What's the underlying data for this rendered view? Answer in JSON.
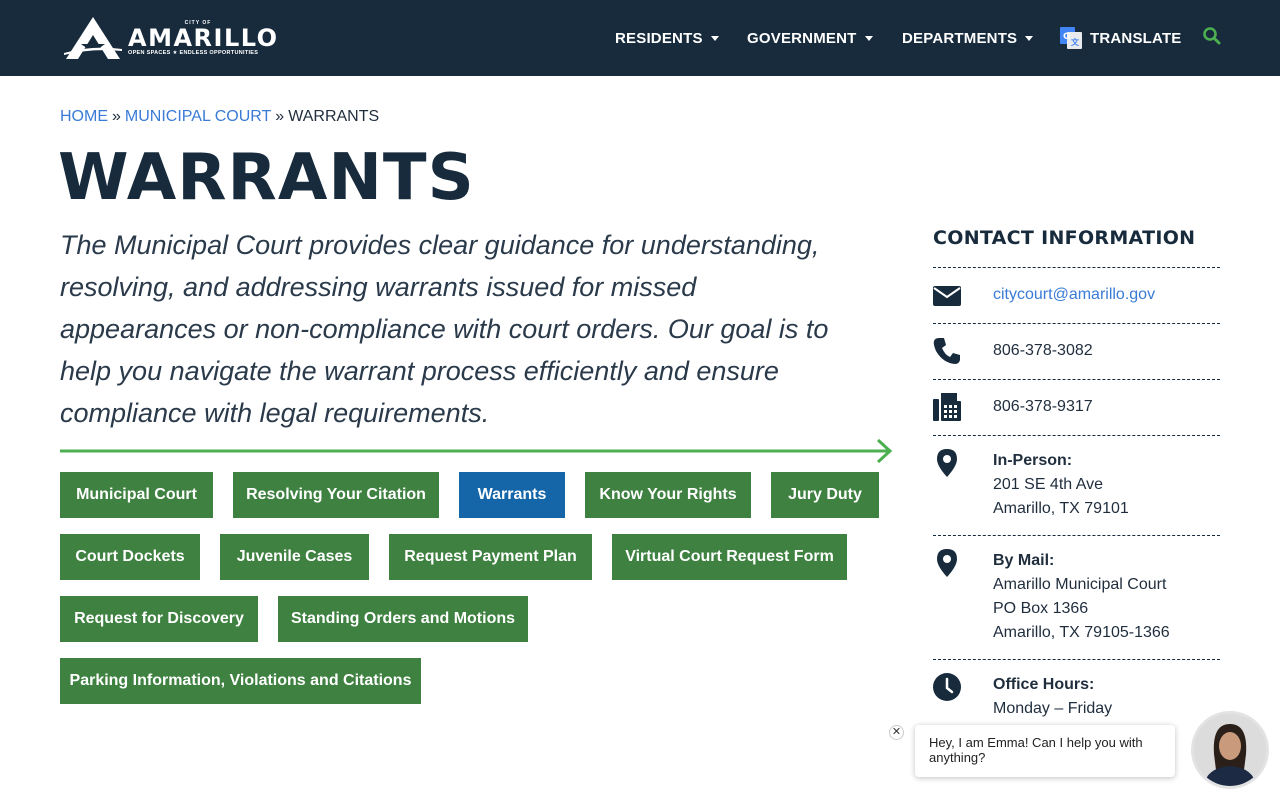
{
  "header": {
    "logo": {
      "city_of": "CITY OF",
      "name": "AMARILLO",
      "tagline": "OPEN SPACES ★ ENDLESS OPPORTUNITIES"
    },
    "nav": [
      {
        "label": "RESIDENTS"
      },
      {
        "label": "GOVERNMENT"
      },
      {
        "label": "DEPARTMENTS"
      },
      {
        "label": "TRANSLATE"
      }
    ],
    "search_icon": "search-icon",
    "colors": {
      "background": "#172b3d",
      "search": "#4caf50"
    }
  },
  "breadcrumb": {
    "home": "HOME",
    "separator": "»",
    "court": "MUNICIPAL COURT",
    "current": "WARRANTS"
  },
  "page": {
    "title": "WARRANTS",
    "intro": "The Municipal Court provides clear guidance for understanding, resolving, and addressing warrants issued for missed appearances or non-compliance with court orders. Our goal is to help you navigate the warrant process efficiently and ensure compliance with legal requirements."
  },
  "section_buttons": [
    {
      "label": "Municipal Court",
      "active": false
    },
    {
      "label": "Resolving Your Citation",
      "active": false
    },
    {
      "label": "Warrants",
      "active": true
    },
    {
      "label": "Know Your Rights",
      "active": false
    },
    {
      "label": "Jury Duty",
      "active": false
    },
    {
      "label": "Court Dockets",
      "active": false
    },
    {
      "label": "Juvenile Cases",
      "active": false
    },
    {
      "label": "Request Payment Plan",
      "active": false
    },
    {
      "label": "Virtual Court Request Form",
      "active": false
    },
    {
      "label": "Request for Discovery",
      "active": false
    },
    {
      "label": "Standing Orders and Motions",
      "active": false
    },
    {
      "label": "Parking Information, Violations and Citations",
      "active": false
    }
  ],
  "button_colors": {
    "default": "#3e8140",
    "active": "#1466a8"
  },
  "contact": {
    "title": "CONTACT INFORMATION",
    "email": "citycourt@amarillo.gov",
    "phone": "806-378-3082",
    "fax": "806-378-9317",
    "in_person": {
      "label": "In-Person:",
      "line1": "201 SE 4th Ave",
      "line2": "Amarillo, TX 79101"
    },
    "mail": {
      "label": "By Mail:",
      "line1": "Amarillo Municipal Court",
      "line2": "PO Box 1366",
      "line3": "Amarillo, TX 79105-1366"
    },
    "hours": {
      "label": "Office Hours:",
      "line1": "Monday – Friday"
    }
  },
  "chat": {
    "close": "✕",
    "message": "Hey, I am Emma! Can I help you with anything?"
  }
}
